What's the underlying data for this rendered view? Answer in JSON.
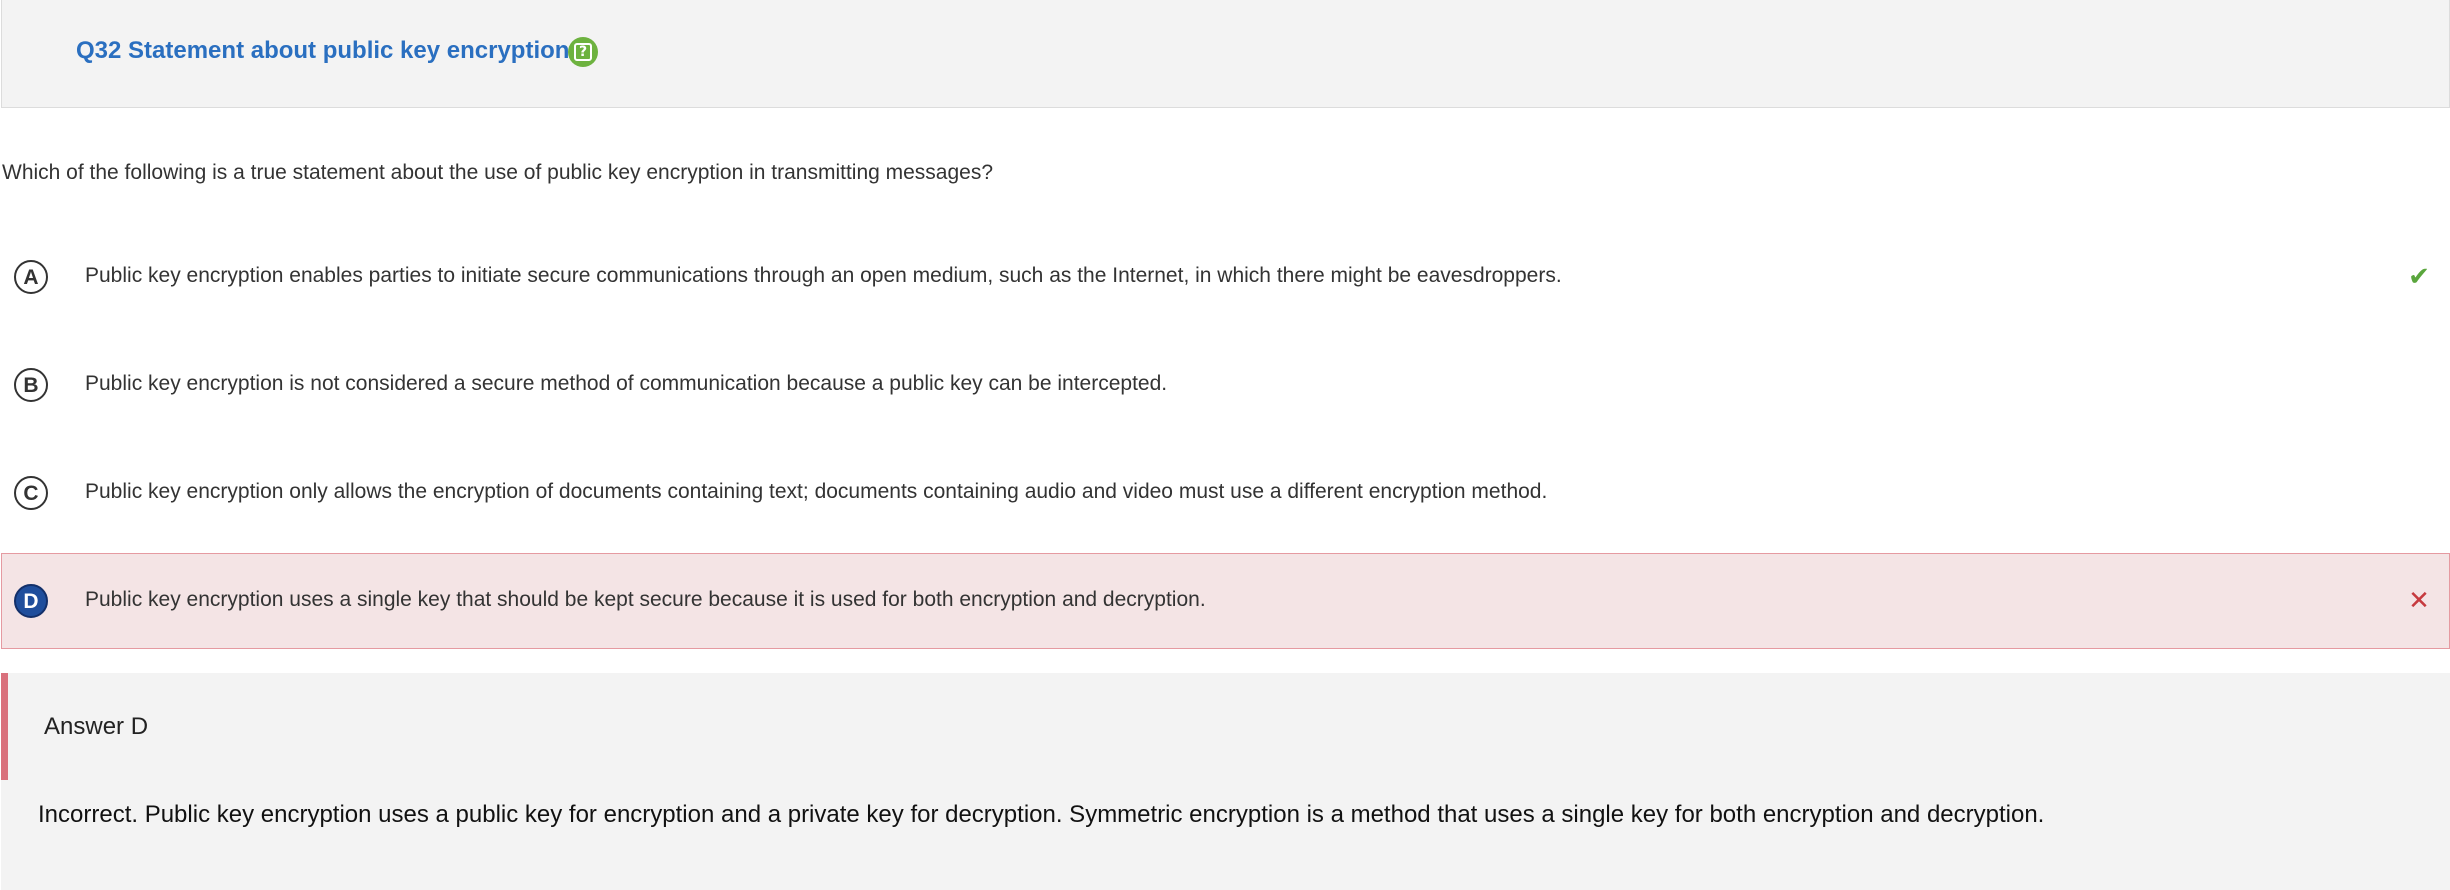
{
  "header": {
    "title": "Q32 Statement about public key encryption",
    "help_icon": "help-question-icon",
    "help_icon_color": "#6db23f"
  },
  "question": {
    "text": "Which of the following is a true statement about the use of public key encryption in transmitting messages?"
  },
  "options": [
    {
      "letter": "A",
      "text": "Public key encryption enables parties to initiate secure communications through an open medium, such as the Internet, in which there might be eavesdroppers.",
      "status": "correct",
      "status_icon": "checkmark-icon"
    },
    {
      "letter": "B",
      "text": "Public key encryption is not considered a secure method of communication because a public key can be intercepted.",
      "status": "none"
    },
    {
      "letter": "C",
      "text": "Public key encryption only allows the encryption of documents containing text; documents containing audio and video must use a different encryption method.",
      "status": "none"
    },
    {
      "letter": "D",
      "text": "Public key encryption uses a single key that should be kept secure because it is used for both encryption and decryption.",
      "status": "selected-incorrect",
      "status_icon": "cross-icon"
    }
  ],
  "feedback": {
    "answer_label": "Answer D",
    "explanation": "Incorrect. Public key encryption uses a public key for encryption and a private key for decryption. Symmetric encryption is a method that uses a single key for both encryption and decryption."
  },
  "colors": {
    "title": "#2a6fc0",
    "correct": "#5aa63d",
    "incorrect": "#c63a3f",
    "selected_bg": "#f4e4e5",
    "selected_letter_bg": "#1f4e9c",
    "feedback_accent": "#d9707c"
  }
}
